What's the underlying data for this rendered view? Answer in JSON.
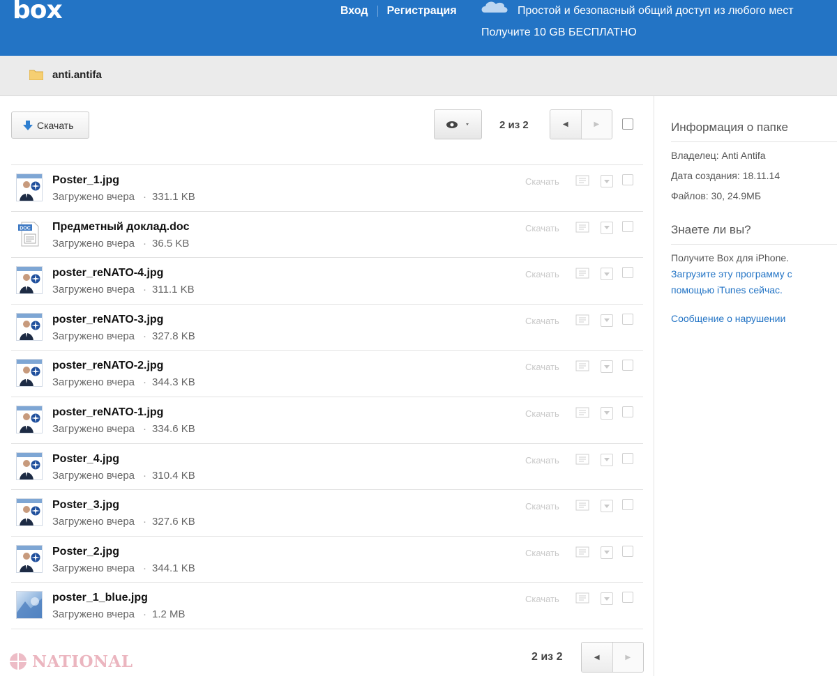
{
  "header": {
    "logo": "box",
    "login": "Вход",
    "signup": "Регистрация",
    "tagline": "Простой и безопасный общий доступ из любого мест",
    "promo": "Получите 10 GB БЕСПЛАТНО"
  },
  "breadcrumb": {
    "folder": "anti.antifa"
  },
  "toolbar": {
    "download_label": "Скачать",
    "pager_text": "2 из 2"
  },
  "files": [
    {
      "name": "Poster_1.jpg",
      "status": "Загружено вчера",
      "size": "331.1 KB",
      "thumb": "poster"
    },
    {
      "name": "Предметный доклад.doc",
      "status": "Загружено вчера",
      "size": "36.5 KB",
      "thumb": "doc"
    },
    {
      "name": "poster_reNATO-4.jpg",
      "status": "Загружено вчера",
      "size": "311.1 KB",
      "thumb": "poster"
    },
    {
      "name": "poster_reNATO-3.jpg",
      "status": "Загружено вчера",
      "size": "327.8 KB",
      "thumb": "poster"
    },
    {
      "name": "poster_reNATO-2.jpg",
      "status": "Загружено вчера",
      "size": "344.3 KB",
      "thumb": "poster"
    },
    {
      "name": "poster_reNATO-1.jpg",
      "status": "Загружено вчера",
      "size": "334.6 KB",
      "thumb": "poster"
    },
    {
      "name": "Poster_4.jpg",
      "status": "Загружено вчера",
      "size": "310.4 KB",
      "thumb": "poster"
    },
    {
      "name": "Poster_3.jpg",
      "status": "Загружено вчера",
      "size": "327.6 KB",
      "thumb": "poster"
    },
    {
      "name": "Poster_2.jpg",
      "status": "Загружено вчера",
      "size": "344.1 KB",
      "thumb": "poster"
    },
    {
      "name": "poster_1_blue.jpg",
      "status": "Загружено вчера",
      "size": "1.2 MB",
      "thumb": "blue"
    }
  ],
  "row_download_label": "Скачать",
  "footer": {
    "pager_text": "2 из 2",
    "watermark": "NATIONAL"
  },
  "sidebar": {
    "info_title": "Информация о папке",
    "owner": "Владелец: Anti Antifa",
    "created": "Дата создания: 18.11.14",
    "files": "Файлов: 30, 24.9МБ",
    "know_title": "Знаете ли вы?",
    "get_box": "Получите Box для iPhone.",
    "itunes_line1": "Загрузите эту программу с",
    "itunes_line2": "помощью iTunes сейчас.",
    "report": "Сообщение о нарушении"
  },
  "colors": {
    "header_bg": "#2374c5",
    "link": "#2374c5"
  }
}
